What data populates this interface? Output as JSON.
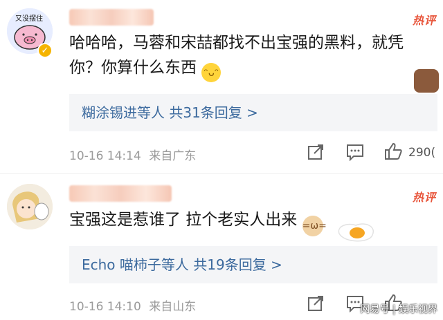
{
  "comments": [
    {
      "avatar_caption": "又没摆住",
      "hot_label": "热评",
      "text_line1": "哈哈哈，马蓉和宋喆都找不出宝强的黑料，就凭",
      "text_line2": "你？你算什么东西",
      "reply_text": "糊涂锡进等人 共31条回复 >",
      "time": "10-16 14:14",
      "location": "来自广东",
      "like_count": "290("
    },
    {
      "hot_label": "热评",
      "text": "宝强这是惹谁了 拉个老实人出来",
      "reply_text": "Echo 喵柿子等人 共19条回复 >",
      "time": "10-16 14:10",
      "location": "来自山东"
    }
  ],
  "watermark": "网易号 | 娱乐视界",
  "colors": {
    "hot": "#e8543a",
    "link": "#3c6a9e",
    "meta": "#9a9a9a",
    "reply_bg": "#f4f5f7"
  }
}
